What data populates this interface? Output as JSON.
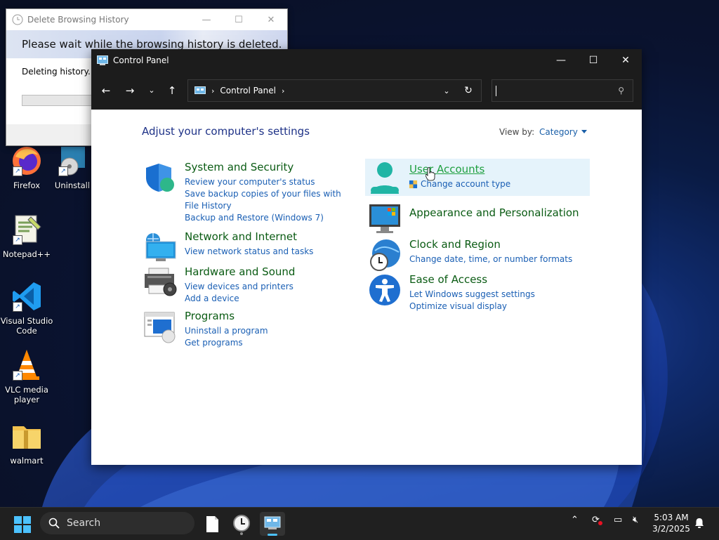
{
  "desktop": {
    "icons": [
      {
        "label": "Firefox"
      },
      {
        "label": "Uninstall"
      },
      {
        "label": "Notepad++"
      },
      {
        "label": "Visual Studio Code"
      },
      {
        "label": "VLC media player"
      },
      {
        "label": "walmart"
      }
    ]
  },
  "history_dialog": {
    "title": "Delete Browsing History",
    "banner": "Please wait while the browsing history is deleted.",
    "message": "Deleting history...",
    "progress": 0
  },
  "control_panel": {
    "title": "Control Panel",
    "breadcrumb": "Control Panel",
    "search_placeholder": "",
    "heading": "Adjust your computer's settings",
    "view_by_label": "View by:",
    "view_by_value": "Category",
    "categories_left": [
      {
        "title": "System and Security",
        "links": [
          "Review your computer's status",
          "Save backup copies of your files with File History",
          "Backup and Restore (Windows 7)"
        ]
      },
      {
        "title": "Network and Internet",
        "links": [
          "View network status and tasks"
        ]
      },
      {
        "title": "Hardware and Sound",
        "links": [
          "View devices and printers",
          "Add a device"
        ]
      },
      {
        "title": "Programs",
        "links": [
          "Uninstall a program",
          "Get programs"
        ]
      }
    ],
    "categories_right": [
      {
        "title": "User Accounts",
        "links": [
          "Change account type"
        ]
      },
      {
        "title": "Appearance and Personalization",
        "links": []
      },
      {
        "title": "Clock and Region",
        "links": [
          "Change date, time, or number formats"
        ]
      },
      {
        "title": "Ease of Access",
        "links": [
          "Let Windows suggest settings",
          "Optimize visual display"
        ]
      }
    ]
  },
  "taskbar": {
    "search_label": "Search",
    "time": "5:03 AM",
    "date": "3/2/2025"
  },
  "colors": {
    "category_title": "#0a5b13",
    "link": "#1a5fb4",
    "heading": "#1e3287",
    "accent": "#4cc2ff"
  }
}
